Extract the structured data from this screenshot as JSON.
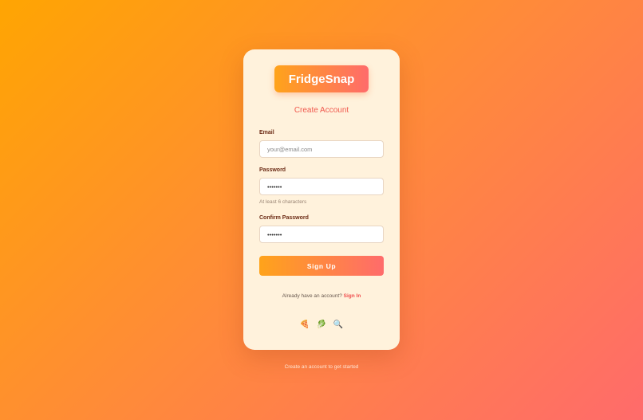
{
  "app": {
    "logo_text": "FridgeSnap",
    "subtitle": "Create Account"
  },
  "form": {
    "email_label": "Email",
    "email_placeholder": "your@email.com",
    "password_label": "Password",
    "password_value": "•••••••",
    "password_hint": "At least 6 characters",
    "confirm_label": "Confirm Password",
    "confirm_value": "•••••••",
    "submit_label": "Sign Up"
  },
  "signin": {
    "prompt": "Already have an account?",
    "link_label": "Sign In"
  },
  "decor_icons": [
    {
      "name": "pizza-icon",
      "glyph": "🍕"
    },
    {
      "name": "herb-icon",
      "glyph": "🥬"
    },
    {
      "name": "magnifier-icon",
      "glyph": "🔍"
    }
  ],
  "footer": {
    "text": "Create an account to get started"
  },
  "colors": {
    "bg_start": "#ffa502",
    "bg_end": "#ff6b6b",
    "card_bg": "#fff2dc",
    "accent": "#f0594e",
    "label_text": "#6b2a14"
  }
}
